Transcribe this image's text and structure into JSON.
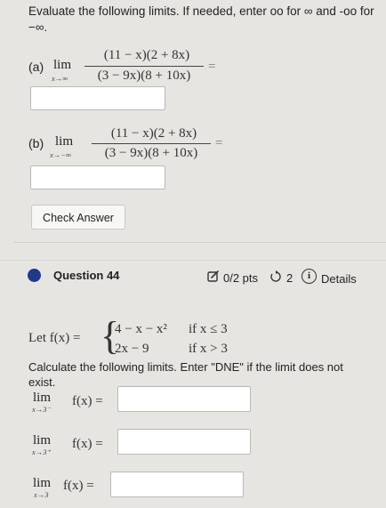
{
  "instructions": "Evaluate the following limits. If needed, enter oo for ∞ and -oo for −∞.",
  "part_a": {
    "label": "(a)",
    "lim": "lim",
    "sub": "x→∞",
    "numerator": "(11 − x)(2 + 8x)",
    "denominator": "(3 − 9x)(8 + 10x)",
    "eq": "="
  },
  "part_b": {
    "label": "(b)",
    "lim": "lim",
    "sub": "x→−∞",
    "numerator": "(11 − x)(2 + 8x)",
    "denominator": "(3 − 9x)(8 + 10x)",
    "eq": "="
  },
  "check_answer_label": "Check Answer",
  "question": {
    "title": "Question 44",
    "points": "0/2 pts",
    "retries": "2",
    "details_label": "Details",
    "info_glyph": "i"
  },
  "piecewise": {
    "lead": "Let f(x) =",
    "row1_expr": "4 − x − x²",
    "row1_cond": "if   x ≤ 3",
    "row2_expr": "2x − 9",
    "row2_cond": "if   x > 3"
  },
  "calc_instructions": "Calculate the following limits. Enter \"DNE\" if the limit does not exist.",
  "limits": [
    {
      "lim": "lim",
      "sub": "x→3⁻",
      "expr": "f(x) ="
    },
    {
      "lim": "lim",
      "sub": "x→3⁺",
      "expr": "f(x) ="
    },
    {
      "lim": "lim",
      "sub": "x→3",
      "expr": "f(x) ="
    }
  ],
  "icons": {
    "points": "checkbox-pencil-icon",
    "retry": "retry-arrow-icon",
    "info": "info-circle-icon",
    "question_marker": "question-dot-icon"
  },
  "colors": {
    "background": "#e6e5e2",
    "question_dot": "#1f3a8a"
  }
}
